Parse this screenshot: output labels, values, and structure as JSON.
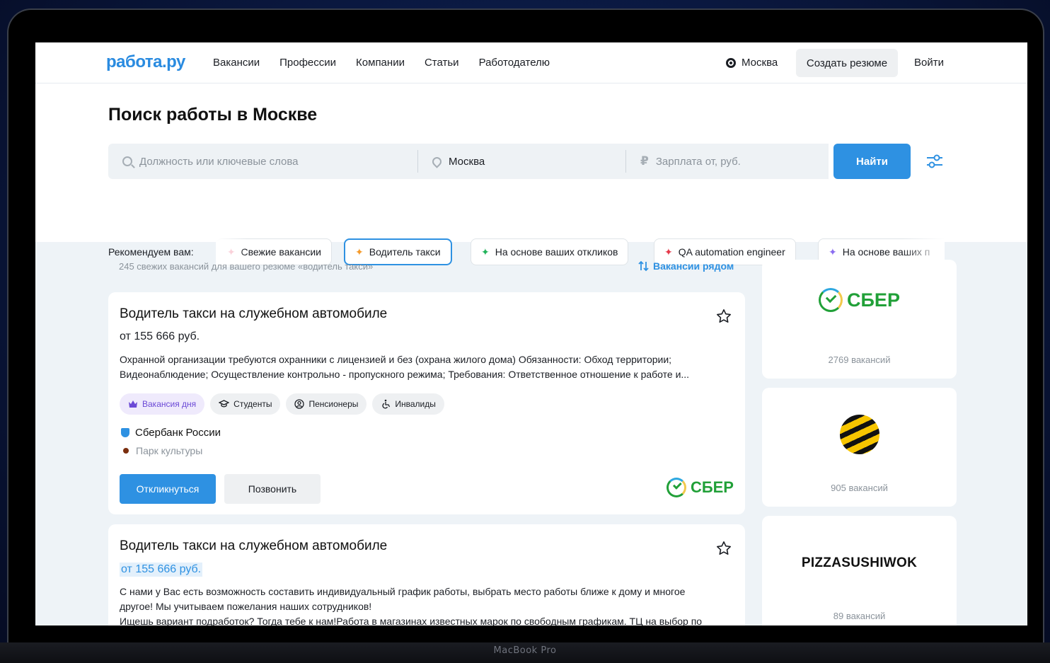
{
  "device": {
    "label": "MacBook Pro"
  },
  "header": {
    "logo": "работа.ру",
    "nav": [
      "Вакансии",
      "Профессии",
      "Компании",
      "Статьи",
      "Работодателю"
    ],
    "city": "Москва",
    "create_resume": "Создать резюме",
    "login": "Войти"
  },
  "search": {
    "title": "Поиск работы в Москве",
    "keywords_placeholder": "Должность или ключевые слова",
    "location_value": "Москва",
    "salary_placeholder": "Зарплата от, руб.",
    "find_button": "Найти"
  },
  "recommend": {
    "label": "Рекомендуем вам:",
    "chips": [
      {
        "label": "Свежие вакансии",
        "icon_color": "#f5a3b5"
      },
      {
        "label": "Водитель такси",
        "icon_color": "#f59a2a",
        "active": true
      },
      {
        "label": "На основе ваших откликов",
        "icon_color": "#21b35a"
      },
      {
        "label": "QA automation engineer",
        "icon_color": "#e5394a"
      },
      {
        "label": "На основе ваших п",
        "icon_color": "#8a6cf0"
      }
    ]
  },
  "results": {
    "count_text": "245 свежих вакансий для вашего резюме «водитель такси»",
    "nearby_label": "Вакансии рядом"
  },
  "vacancies": [
    {
      "title": "Водитель такси на служебном автомобиле",
      "salary": "от 155 666 руб.",
      "description_line1": "Охранной организации требуются охранники с лицензией и без (охрана жилого дома) Обязанности: Обход территории;",
      "description_line2": "Видеонаблюдение; Осуществление контрольно - пропускного режима; Требования: Ответственное отношение к работе и...",
      "tags": [
        "Вакансия дня",
        "Студенты",
        "Пенсионеры",
        "Инвалиды"
      ],
      "company": "Сбербанк России",
      "metro": "Парк культуры",
      "apply_button": "Откликнуться",
      "call_button": "Позвонить",
      "company_logo_text": "СБЕР"
    },
    {
      "title": "Водитель такси на служебном автомобиле",
      "salary": "от 155 666 руб.",
      "description_line1": "С нами у Вас есть возможность составить индивидуальный график работы, выбрать место работы ближе к дому и многое",
      "description_line2": "другое! Мы учитываем пожелания наших сотрудников!",
      "description_line3": "Ищешь вариант подработок? Тогда тебе к нам!Работа в магазинах известных марок по свободным графикам. ТЦ на выбор по"
    }
  ],
  "sidebar": [
    {
      "logo_text": "СБЕР",
      "count": "2769 вакансий"
    },
    {
      "logo_text": "",
      "count": "905 вакансий"
    },
    {
      "logo_text": "PIZZASUSHIWOK",
      "count": "89 вакансий"
    }
  ],
  "colors": {
    "accent": "#2e91e2",
    "sber_green": "#21a038",
    "vacancy_day": "#6b49d6"
  }
}
